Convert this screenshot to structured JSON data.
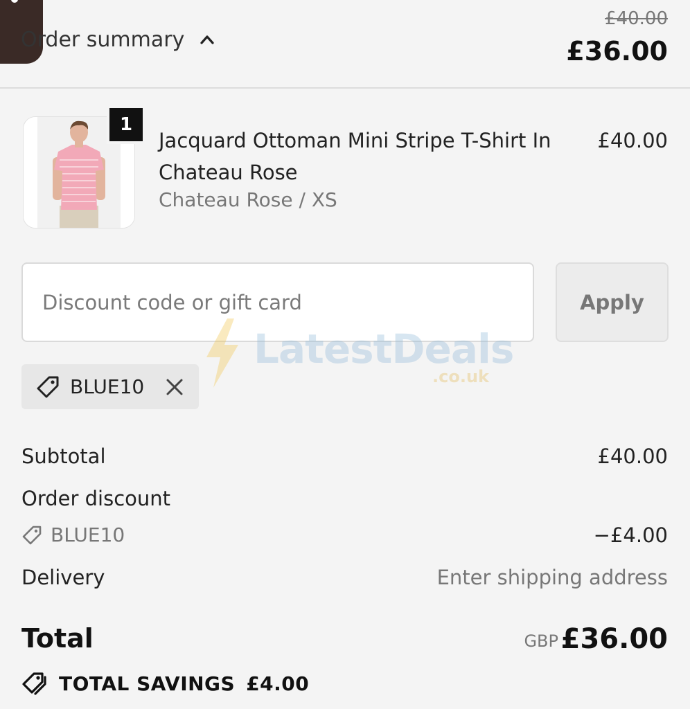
{
  "header": {
    "summary_label": "Order summary",
    "original_total": "£40.00",
    "total": "£36.00"
  },
  "item": {
    "quantity": "1",
    "name": "Jacquard Ottoman Mini Stripe T-Shirt In Chateau Rose",
    "variant": "Chateau Rose / XS",
    "price": "£40.00"
  },
  "discount": {
    "placeholder": "Discount code or gift card",
    "apply_label": "Apply",
    "applied_code": "BLUE10"
  },
  "summary": {
    "subtotal_label": "Subtotal",
    "subtotal_value": "£40.00",
    "order_discount_label": "Order discount",
    "discount_code": "BLUE10",
    "discount_value": "−£4.00",
    "delivery_label": "Delivery",
    "delivery_value": "Enter shipping address",
    "total_label": "Total",
    "currency": "GBP",
    "total_value": "£36.00",
    "savings_label": "TOTAL SAVINGS",
    "savings_value": "£4.00"
  },
  "watermark": {
    "brand": "LatestDeals",
    "domain": ".co.uk"
  },
  "colors": {
    "background": "#f4f4f4",
    "text": "#1b1b1b",
    "muted": "#777777",
    "badge": "#111111",
    "shirt": "#f2a9b8"
  },
  "icons": [
    "chevron-up-icon",
    "tag-icon",
    "close-icon",
    "tags-icon"
  ]
}
